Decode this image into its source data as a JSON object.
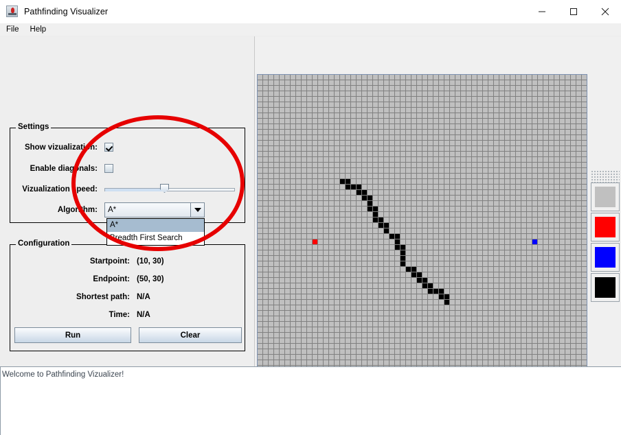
{
  "window": {
    "title": "Pathfinding Visualizer",
    "icon": "java-app-icon",
    "controls": {
      "minimize": "minimize-icon",
      "maximize": "maximize-icon",
      "close": "close-icon"
    }
  },
  "menubar": {
    "items": [
      {
        "label": "File"
      },
      {
        "label": "Help"
      }
    ]
  },
  "settings": {
    "group_title": "Settings",
    "show_visualization": {
      "label": "Show vizualization:",
      "checked": true
    },
    "enable_diagonals": {
      "label": "Enable diagonals:",
      "checked": false
    },
    "visualization_speed": {
      "label": "Vizualization speed:",
      "value_percent": 46
    },
    "algorithm": {
      "label": "Algorithm:",
      "selected": "A*",
      "expanded": true,
      "options": [
        "A*",
        "Breadth First Search"
      ]
    }
  },
  "configuration": {
    "group_title": "Configuration",
    "rows": [
      {
        "label": "Startpoint:",
        "value": "(10, 30)"
      },
      {
        "label": "Endpoint:",
        "value": "(50, 30)"
      },
      {
        "label": "Shortest path:",
        "value": "N/A"
      },
      {
        "label": "Time:",
        "value": "N/A"
      }
    ],
    "run_button": "Run",
    "clear_button": "Clear"
  },
  "palette": {
    "grip": "drag-handle-icon",
    "swatches": [
      {
        "name": "empty",
        "color": "#c0c0c0"
      },
      {
        "name": "start",
        "color": "#ff0000"
      },
      {
        "name": "end",
        "color": "#0000ff"
      },
      {
        "name": "wall",
        "color": "#000000"
      }
    ]
  },
  "grid": {
    "cell_size": 8,
    "cols": 60,
    "rows": 60,
    "start_cell": {
      "col": 10,
      "row": 30,
      "color": "#ff0000"
    },
    "end_cell": {
      "col": 50,
      "row": 30,
      "color": "#0000ff"
    },
    "wall_color": "#000000",
    "walls": [
      [
        15,
        19
      ],
      [
        16,
        19
      ],
      [
        16,
        20
      ],
      [
        17,
        20
      ],
      [
        18,
        20
      ],
      [
        18,
        21
      ],
      [
        19,
        21
      ],
      [
        19,
        22
      ],
      [
        20,
        22
      ],
      [
        20,
        23
      ],
      [
        20,
        24
      ],
      [
        21,
        24
      ],
      [
        21,
        25
      ],
      [
        21,
        26
      ],
      [
        22,
        26
      ],
      [
        22,
        27
      ],
      [
        23,
        27
      ],
      [
        23,
        28
      ],
      [
        24,
        29
      ],
      [
        25,
        29
      ],
      [
        25,
        30
      ],
      [
        25,
        31
      ],
      [
        26,
        31
      ],
      [
        26,
        32
      ],
      [
        26,
        33
      ],
      [
        26,
        34
      ],
      [
        27,
        35
      ],
      [
        28,
        35
      ],
      [
        28,
        36
      ],
      [
        29,
        36
      ],
      [
        29,
        37
      ],
      [
        30,
        37
      ],
      [
        30,
        38
      ],
      [
        31,
        38
      ],
      [
        31,
        39
      ],
      [
        32,
        39
      ],
      [
        33,
        39
      ],
      [
        33,
        40
      ],
      [
        34,
        40
      ],
      [
        34,
        41
      ]
    ]
  },
  "statusbar": {
    "message": "Welcome to Pathfinding Vizualizer!"
  },
  "annotation": {
    "shape": "ellipse",
    "color": "#e60000"
  }
}
